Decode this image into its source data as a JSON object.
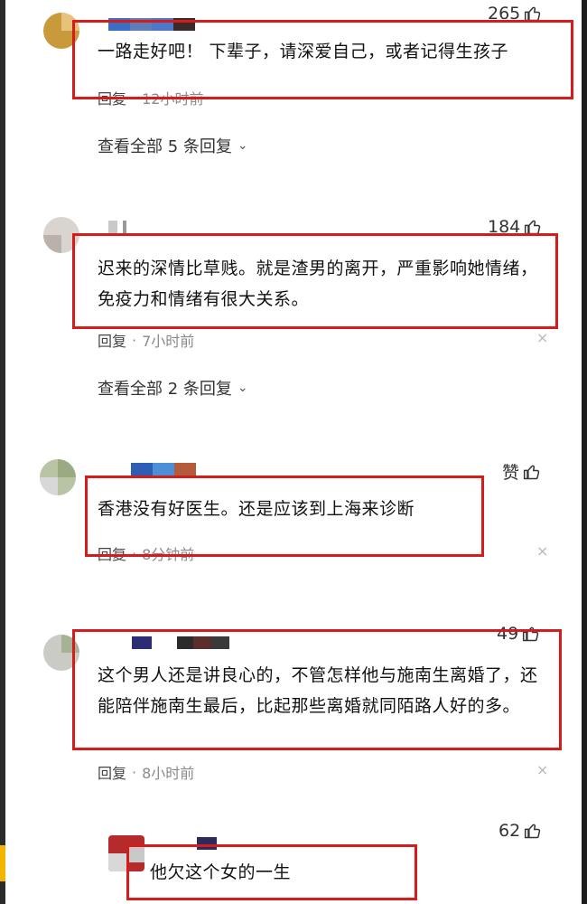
{
  "comments": [
    {
      "likes": "265",
      "text": "一路走好吧！ 下辈子，请深爱自己，或者记得生孩子",
      "reply_label": "回复",
      "dot": "·",
      "time": "12小时前",
      "view_all": "查看全部 5 条回复"
    },
    {
      "likes": "184",
      "text": "迟来的深情比草贱。就是渣男的离开，严重影响她情绪，免疫力和情绪有很大关系。",
      "reply_label": "回复",
      "dot": "·",
      "time": "7小时前",
      "view_all": "查看全部 2 条回复"
    },
    {
      "likes": "赞",
      "text": "香港没有好医生。还是应该到上海来诊断",
      "reply_label": "回复",
      "dot": "·",
      "time": "8分钟前"
    },
    {
      "likes": "49",
      "text": "这个男人还是讲良心的，不管怎样他与施南生离婚了，还能陪伴施南生最后，比起那些离婚就同陌路人好的多。",
      "reply_label": "回复",
      "dot": "·",
      "time": "8小时前"
    },
    {
      "likes": "62",
      "text": "他欠这个女的一生"
    }
  ],
  "close_glyph": "×",
  "chevron_glyph": "⌄",
  "icons": {
    "like": "thumbs-up-icon",
    "close": "close-icon",
    "chevron": "chevron-down-icon"
  },
  "colors": {
    "highlight_box": "#d61b1b"
  }
}
